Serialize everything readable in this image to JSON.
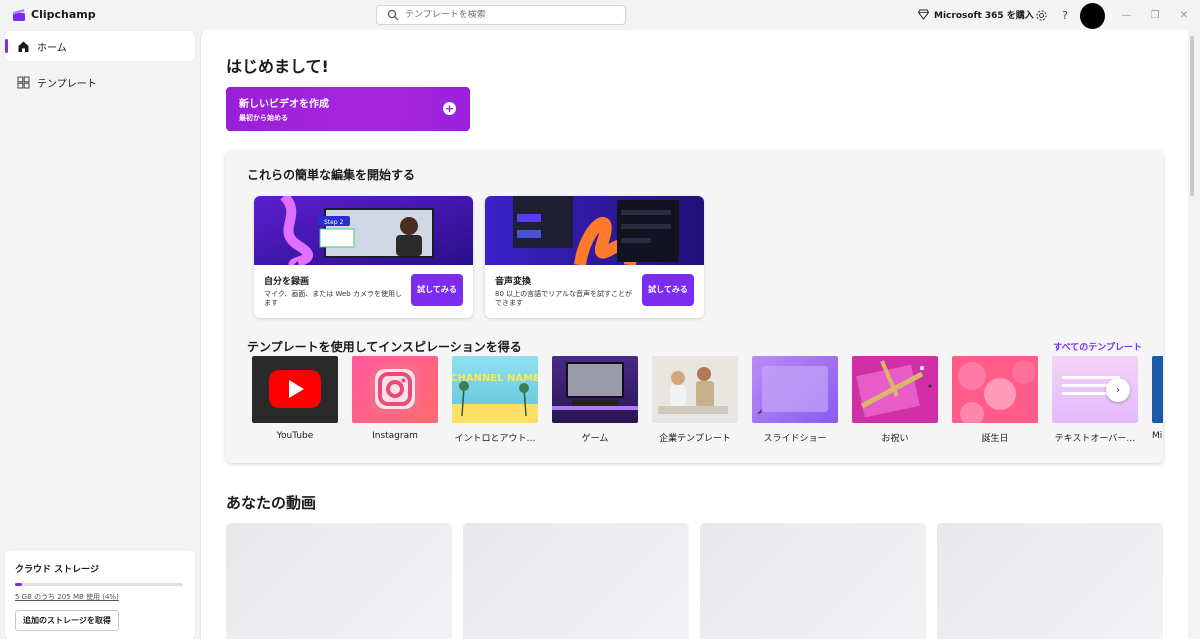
{
  "titlebar": {
    "app_name": "Clipchamp",
    "search_placeholder": "テンプレートを検索",
    "ms365_label": "Microsoft 365 を購入",
    "help_label": "?",
    "window_minimize": "—",
    "window_restore": "❐",
    "window_close": "✕"
  },
  "sidebar": {
    "items": [
      {
        "label": "ホーム",
        "icon": "home-icon",
        "active": true
      },
      {
        "label": "テンプレート",
        "icon": "templates-icon",
        "active": false
      }
    ],
    "storage": {
      "title": "クラウド ストレージ",
      "usage": "5 GB のうち 205 MB 使用 (4%)",
      "percent": 4,
      "button": "追加のストレージを取得"
    }
  },
  "main": {
    "greeting": "はじめまして!",
    "create": {
      "title": "新しいビデオを作成",
      "subtitle": "最初から始める"
    },
    "quick_edits": {
      "title": "これらの簡単な編集を開始する",
      "cards": [
        {
          "name": "自分を録画",
          "desc": "マイク、画面、または Web カメラを使用します",
          "button": "試してみる",
          "thumb_label": "Step 2"
        },
        {
          "name": "音声変換",
          "desc": "80 以上の言語でリアルな音声を試すことができます",
          "button": "試してみる"
        }
      ]
    },
    "templates": {
      "title": "テンプレートを使用してインスピレーションを得る",
      "all_link": "すべてのテンプレート",
      "items": [
        {
          "label": "YouTube",
          "icon": "youtube-icon"
        },
        {
          "label": "Instagram",
          "icon": "instagram-icon"
        },
        {
          "label": "イントロとアウト…",
          "icon": "intro-thumbnail",
          "thumb_text": "CHANNEL NAME"
        },
        {
          "label": "ゲーム",
          "icon": "gaming-thumbnail"
        },
        {
          "label": "企業テンプレート",
          "icon": "corporate-thumbnail"
        },
        {
          "label": "スライドショー",
          "icon": "slideshow-thumbnail"
        },
        {
          "label": "お祝い",
          "icon": "celebration-thumbnail"
        },
        {
          "label": "誕生日",
          "icon": "birthday-thumbnail"
        },
        {
          "label": "テキストオーバー…",
          "icon": "text-overlay-thumbnail"
        },
        {
          "label": "Mi",
          "icon": "more-thumbnail"
        }
      ],
      "next_label": "›"
    },
    "videos": {
      "title": "あなたの動画"
    }
  },
  "colors": {
    "accent": "#7b2cf0",
    "create_gradient": "#9a1fd8",
    "youtube_red": "#ff0000"
  }
}
